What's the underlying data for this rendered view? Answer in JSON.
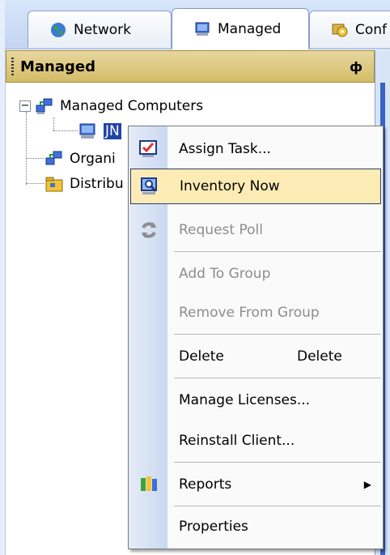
{
  "tabs": [
    {
      "label": "Network",
      "icon": "globe-icon"
    },
    {
      "label": "Managed",
      "icon": "monitor-icon",
      "active": true
    },
    {
      "label": "Conf",
      "icon": "config-icon"
    }
  ],
  "panel": {
    "title": "Managed",
    "pin_glyph": "ф"
  },
  "tree": {
    "root_label": "Managed Computers",
    "expander": "−",
    "child_label": "JN",
    "org_label": "Organi",
    "dist_label": "Distribu"
  },
  "menu": {
    "assign_task": "Assign Task...",
    "inventory_now": "Inventory Now",
    "request_poll": "Request Poll",
    "add_to_group": "Add To Group",
    "remove_from_group": "Remove From Group",
    "delete": "Delete",
    "delete_shortcut": "Delete",
    "manage_licenses": "Manage Licenses...",
    "reinstall_client": "Reinstall Client...",
    "reports": "Reports",
    "properties": "Properties"
  },
  "colors": {
    "hover_bg": "#fcebb4",
    "header_bg": "#d4bc66",
    "selection": "#1f44a8"
  }
}
